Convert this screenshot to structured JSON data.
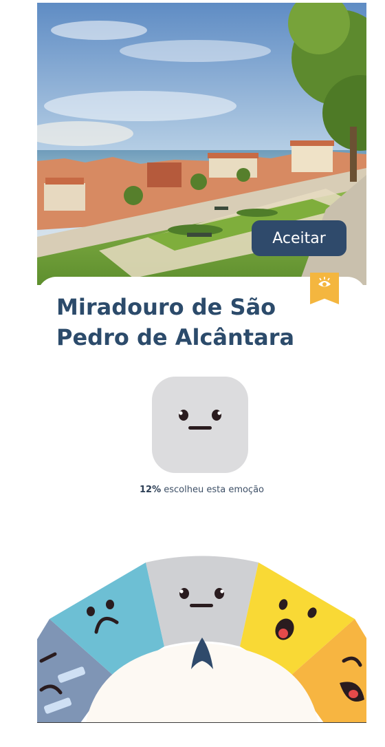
{
  "place": {
    "title_line1": "Miradouro de São",
    "title_line2": "Pedro de Alcântara"
  },
  "actions": {
    "accept_label": "Aceitar"
  },
  "selection": {
    "percent": "12%",
    "caption": " escolheu esta emoção"
  },
  "emotions": [
    {
      "name": "angry",
      "color": "#7f95b5"
    },
    {
      "name": "sad",
      "color": "#6dbfd4"
    },
    {
      "name": "neutral",
      "color": "#cfd0d3",
      "selected": true
    },
    {
      "name": "surprised",
      "color": "#f9d935"
    },
    {
      "name": "laughing",
      "color": "#f7b541"
    }
  ],
  "colors": {
    "primary": "#2f4a6b",
    "bookmark": "#f4b63f",
    "title": "#2c4b6b"
  },
  "icons": {
    "bookmark": "eye-icon",
    "pointer": "chevron-up-icon"
  }
}
